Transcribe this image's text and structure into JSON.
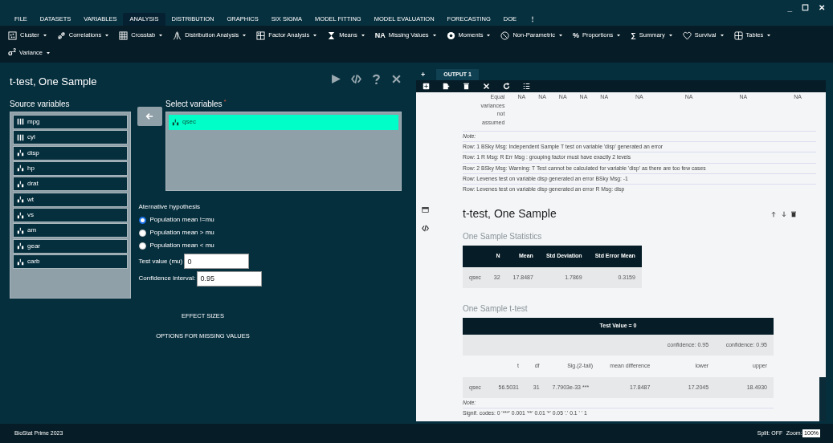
{
  "window": {
    "controls": [
      "_",
      "☐",
      "✕"
    ]
  },
  "menu": [
    {
      "label": "FILE",
      "selected": false
    },
    {
      "label": "DATASETS",
      "selected": false
    },
    {
      "label": "VARIABLES",
      "selected": false
    },
    {
      "label": "ANALYSIS",
      "selected": true
    },
    {
      "label": "DISTRIBUTION",
      "selected": false
    },
    {
      "label": "GRAPHICS",
      "selected": false
    },
    {
      "label": "SIX SIGMA",
      "selected": false
    },
    {
      "label": "MODEL FITTING",
      "selected": false
    },
    {
      "label": "MODEL EVALUATION",
      "selected": false
    },
    {
      "label": "FORECASTING",
      "selected": false
    },
    {
      "label": "DOE",
      "selected": false
    }
  ],
  "menu_more": "⋮",
  "toolbar": [
    {
      "label": "Cluster"
    },
    {
      "label": "Correlations"
    },
    {
      "label": "Crosstab"
    },
    {
      "label": "Distribution Analysis"
    },
    {
      "label": "Factor Analysis"
    },
    {
      "label": "Means"
    },
    {
      "label": "Missing Values",
      "glyph": "NA"
    },
    {
      "label": "Moments"
    },
    {
      "label": "Non-Parametric"
    },
    {
      "label": "Proportions",
      "glyph": "%"
    },
    {
      "label": "Summary",
      "glyph": "∑"
    },
    {
      "label": "Survival"
    },
    {
      "label": "Tables"
    },
    {
      "label": "Variance",
      "glyph": "σ$^{2}$"
    }
  ],
  "dialog": {
    "title": "t-test, One Sample",
    "source_label": "Source variables",
    "source_variables": [
      {
        "name": "mpg",
        "kind": "nominal"
      },
      {
        "name": "cyl",
        "kind": "nominal"
      },
      {
        "name": "disp",
        "kind": "scale"
      },
      {
        "name": "hp",
        "kind": "scale"
      },
      {
        "name": "drat",
        "kind": "scale"
      },
      {
        "name": "wt",
        "kind": "scale"
      },
      {
        "name": "vs",
        "kind": "scale"
      },
      {
        "name": "am",
        "kind": "scale"
      },
      {
        "name": "gear",
        "kind": "scale"
      },
      {
        "name": "carb",
        "kind": "scale"
      }
    ],
    "select_label": "Select variables",
    "required_mark": "*",
    "selected_variables": [
      {
        "name": "qsec",
        "kind": "scale",
        "selected": true
      }
    ],
    "hypothesis_label": "Aternative hypothesis",
    "hypotheses": [
      {
        "label": "Population mean !=mu",
        "selected": true
      },
      {
        "label": "Population mean > mu",
        "selected": false
      },
      {
        "label": "Population mean < mu",
        "selected": false
      }
    ],
    "test_value": {
      "label": "Test value (mu)",
      "value": "0"
    },
    "confidence": {
      "label": "Confidence interval:",
      "value": "0.95"
    },
    "sections": [
      "EFFECT SIZES",
      "OPTIONS FOR MISSING VALUES"
    ]
  },
  "output": {
    "add": "+",
    "tabs": [
      {
        "label": "OUTPUT 1",
        "selected": true
      }
    ],
    "prev_row": {
      "label": "Equal variances not assumed",
      "values": [
        "NA",
        "NA",
        "NA",
        "NA",
        "NA",
        "NA",
        "NA",
        "NA",
        "NA"
      ]
    },
    "prev_note": "Note:",
    "prev_messages": [
      "Row: 1 BSky Msg: Independent Sample T test on variable 'disp' generated an error",
      "Row: 1 R Msg: R Err Msg : grouping factor must have exactly 2 levels",
      "Row: 2 BSky Msg: Warning: T Test cannot be calculated for variable 'disp' as there are too few cases",
      "Row: Levenes test on variable disp generated an error BSky Msg: -1",
      "Row: Levenes test on variable disp generated an error R Msg: disp"
    ],
    "title": "t-test, One Sample",
    "stats_title": "One Sample Statistics",
    "stats_columns": [
      "",
      "N",
      "Mean",
      "Std Deviation",
      "Std Error Mean"
    ],
    "stats_rows": [
      [
        "qsec",
        "32",
        "17.8487",
        "1.7869",
        "0.3159"
      ]
    ],
    "ttest_title": "One Sample t-test",
    "ttest_group": "Test Value = 0",
    "ttest_confidence": [
      "confidence: 0.95",
      "confidence: 0.95"
    ],
    "ttest_columns": [
      "",
      "t",
      "df",
      "Sig.(2-tail)",
      "mean difference",
      "lower",
      "upper"
    ],
    "ttest_rows": [
      [
        "qsec",
        "56.5031",
        "31",
        "7.7903e-33 ***",
        "17.8487",
        "17.2045",
        "18.4930"
      ]
    ],
    "note": "Note:",
    "signif": "Signif. codes: 0 '***' 0.001 '**' 0.01 '*' 0.05 '.' 0.1 ' ' 1"
  },
  "status_bar": {
    "app": "BioStat Prime 2023",
    "split": "Split: OFF",
    "zoom_label": "Zoom:",
    "zoom": "100%"
  }
}
